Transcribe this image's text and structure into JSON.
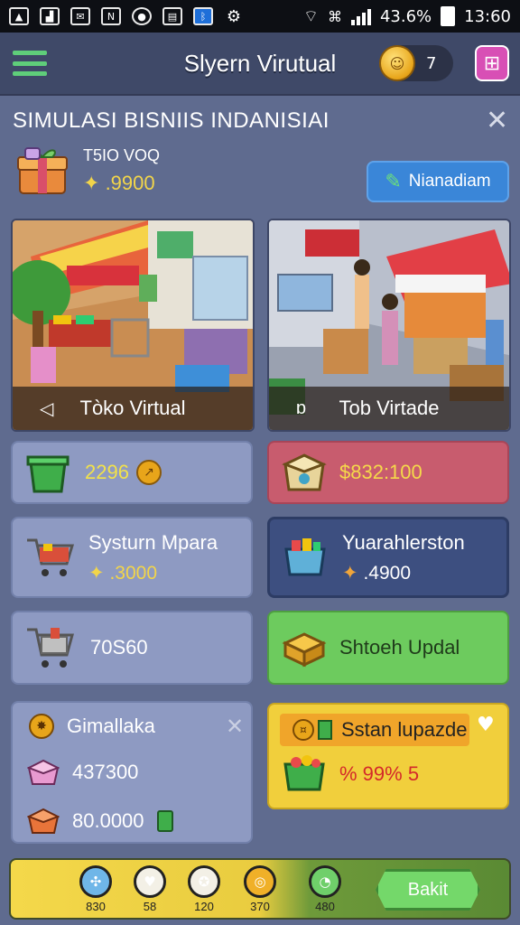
{
  "status_bar": {
    "battery": "43.6%",
    "time": "13:60"
  },
  "app_bar": {
    "title": "Slyern Virutual",
    "coin_count": "7"
  },
  "section": {
    "title": "SIMULASI BISNIIS INDANISIAI"
  },
  "shop": {
    "name": "T5IO VOQ",
    "price": ".9900",
    "manage_label": "Nianadiam"
  },
  "stores": [
    {
      "label": "Tòko Virtual"
    },
    {
      "label": "Tob Virtade"
    }
  ],
  "cards": {
    "green_bin": {
      "value": "2296"
    },
    "box_money": {
      "value": "$832:100"
    },
    "system": {
      "title": "Systurn Mpara",
      "price": ".3000"
    },
    "warehouse": {
      "title": "Yuarahlerston",
      "price": ".4900"
    },
    "cart_value": {
      "value": "70S60"
    },
    "stock_update": {
      "title": "Shtoeh Updal"
    },
    "summary": {
      "title": "Gimallaka",
      "value1": "437300",
      "value2": "80.0000"
    },
    "upgrade": {
      "title": "Sstan lupazde",
      "value": "% 99% 5"
    }
  },
  "bottom_nav": [
    {
      "icon": "butterfly-icon",
      "value": "830"
    },
    {
      "icon": "heart-icon",
      "value": "58"
    },
    {
      "icon": "ribbon-icon",
      "value": "120"
    },
    {
      "icon": "coin-icon",
      "value": "370"
    },
    {
      "icon": "clock-icon",
      "value": "480"
    }
  ],
  "start_label": "Bakit",
  "colors": {
    "background": "#5f6b8f",
    "gold": "#f2d54a",
    "card_blue": "#8e9ac2",
    "card_red": "#c85c6e",
    "card_navy": "#3d4f80",
    "card_green": "#6dcb5e",
    "card_yellow": "#f1cf3c"
  }
}
